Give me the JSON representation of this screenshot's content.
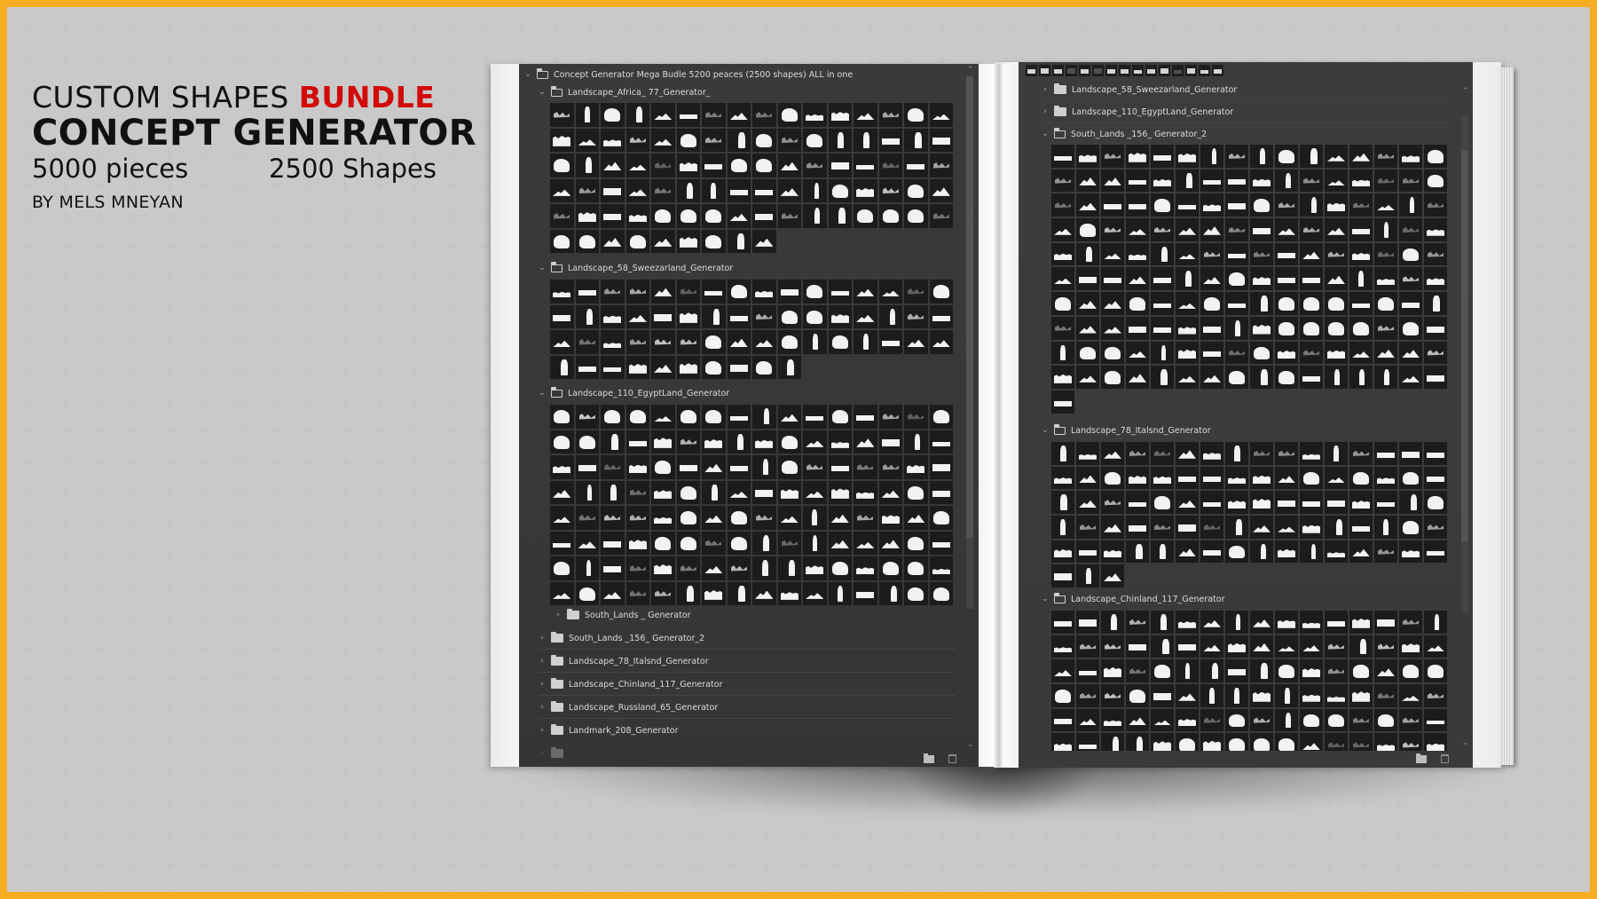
{
  "promo": {
    "line1_prefix": "CUSTOM SHAPES ",
    "line1_accent": "BUNDLE",
    "line2": "CONCEPT GENERATOR",
    "pieces": "5000 pieces",
    "shapes": "2500 Shapes",
    "author": "BY MELS MNEYAN",
    "accent_color": "#d10a0a",
    "frame_color": "#f6ad22"
  },
  "left_panel": {
    "root": {
      "label": "Concept Generator Mega Budle 5200 peaces (2500 shapes) ALL in one",
      "expanded": true
    },
    "groups": [
      {
        "label": "Landscape_Africa_ 77_Generator_",
        "expanded": true,
        "tile_count": 89
      },
      {
        "label": "Landscape_58_Sweezarland_Generator",
        "expanded": true,
        "tile_count": 58
      },
      {
        "label": "Landscape_110_EgyptLand_Generator",
        "expanded": true,
        "tile_count": 128
      }
    ],
    "subfolder": {
      "label": "South_Lands _ Generator",
      "expanded": false
    },
    "collapsed_groups": [
      {
        "label": "South_Lands _156_ Generator_2"
      },
      {
        "label": "Landscape_78_Italsnd_Generator"
      },
      {
        "label": "Landscape_Chinland_117_Generator"
      },
      {
        "label": "Landscape_Russland_65_Generator"
      },
      {
        "label": "Landmark_208_Generator"
      }
    ]
  },
  "right_panel": {
    "toolbar_tile_count": 15,
    "collapsed_groups": [
      {
        "label": "Landscape_58_Sweezarland_Generator"
      },
      {
        "label": "Landscape_110_EgyptLand_Generator"
      }
    ],
    "groups": [
      {
        "label": "South_Lands _156_ Generator_2",
        "expanded": true,
        "tile_count": 161
      },
      {
        "label": "Landscape_78_Italsnd_Generator",
        "expanded": true,
        "tile_count": 83
      },
      {
        "label": "Landscape_Chinland_117_Generator",
        "expanded": true,
        "tile_count": 96
      }
    ]
  },
  "icons": {
    "expand": "chevron-down-icon",
    "collapse": "chevron-right-icon",
    "folder": "folder-icon",
    "new_group": "new-folder-icon",
    "delete": "trash-icon"
  }
}
